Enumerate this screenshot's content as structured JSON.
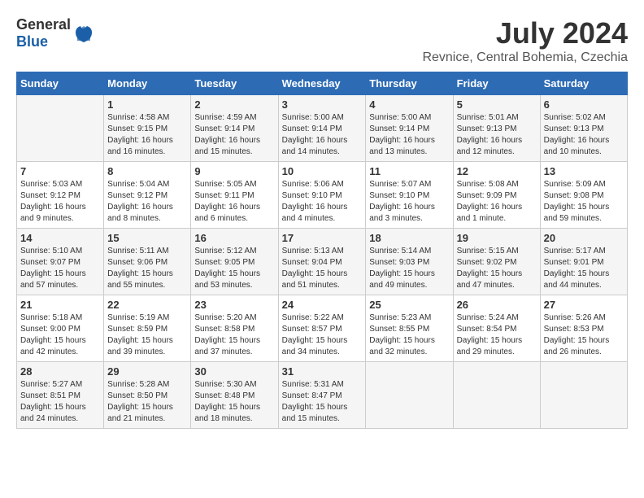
{
  "logo": {
    "general": "General",
    "blue": "Blue"
  },
  "title": {
    "month_year": "July 2024",
    "location": "Revnice, Central Bohemia, Czechia"
  },
  "headers": [
    "Sunday",
    "Monday",
    "Tuesday",
    "Wednesday",
    "Thursday",
    "Friday",
    "Saturday"
  ],
  "weeks": [
    [
      {
        "day": "",
        "sunrise": "",
        "sunset": "",
        "daylight": ""
      },
      {
        "day": "1",
        "sunrise": "Sunrise: 4:58 AM",
        "sunset": "Sunset: 9:15 PM",
        "daylight": "Daylight: 16 hours and 16 minutes."
      },
      {
        "day": "2",
        "sunrise": "Sunrise: 4:59 AM",
        "sunset": "Sunset: 9:14 PM",
        "daylight": "Daylight: 16 hours and 15 minutes."
      },
      {
        "day": "3",
        "sunrise": "Sunrise: 5:00 AM",
        "sunset": "Sunset: 9:14 PM",
        "daylight": "Daylight: 16 hours and 14 minutes."
      },
      {
        "day": "4",
        "sunrise": "Sunrise: 5:00 AM",
        "sunset": "Sunset: 9:14 PM",
        "daylight": "Daylight: 16 hours and 13 minutes."
      },
      {
        "day": "5",
        "sunrise": "Sunrise: 5:01 AM",
        "sunset": "Sunset: 9:13 PM",
        "daylight": "Daylight: 16 hours and 12 minutes."
      },
      {
        "day": "6",
        "sunrise": "Sunrise: 5:02 AM",
        "sunset": "Sunset: 9:13 PM",
        "daylight": "Daylight: 16 hours and 10 minutes."
      }
    ],
    [
      {
        "day": "7",
        "sunrise": "Sunrise: 5:03 AM",
        "sunset": "Sunset: 9:12 PM",
        "daylight": "Daylight: 16 hours and 9 minutes."
      },
      {
        "day": "8",
        "sunrise": "Sunrise: 5:04 AM",
        "sunset": "Sunset: 9:12 PM",
        "daylight": "Daylight: 16 hours and 8 minutes."
      },
      {
        "day": "9",
        "sunrise": "Sunrise: 5:05 AM",
        "sunset": "Sunset: 9:11 PM",
        "daylight": "Daylight: 16 hours and 6 minutes."
      },
      {
        "day": "10",
        "sunrise": "Sunrise: 5:06 AM",
        "sunset": "Sunset: 9:10 PM",
        "daylight": "Daylight: 16 hours and 4 minutes."
      },
      {
        "day": "11",
        "sunrise": "Sunrise: 5:07 AM",
        "sunset": "Sunset: 9:10 PM",
        "daylight": "Daylight: 16 hours and 3 minutes."
      },
      {
        "day": "12",
        "sunrise": "Sunrise: 5:08 AM",
        "sunset": "Sunset: 9:09 PM",
        "daylight": "Daylight: 16 hours and 1 minute."
      },
      {
        "day": "13",
        "sunrise": "Sunrise: 5:09 AM",
        "sunset": "Sunset: 9:08 PM",
        "daylight": "Daylight: 15 hours and 59 minutes."
      }
    ],
    [
      {
        "day": "14",
        "sunrise": "Sunrise: 5:10 AM",
        "sunset": "Sunset: 9:07 PM",
        "daylight": "Daylight: 15 hours and 57 minutes."
      },
      {
        "day": "15",
        "sunrise": "Sunrise: 5:11 AM",
        "sunset": "Sunset: 9:06 PM",
        "daylight": "Daylight: 15 hours and 55 minutes."
      },
      {
        "day": "16",
        "sunrise": "Sunrise: 5:12 AM",
        "sunset": "Sunset: 9:05 PM",
        "daylight": "Daylight: 15 hours and 53 minutes."
      },
      {
        "day": "17",
        "sunrise": "Sunrise: 5:13 AM",
        "sunset": "Sunset: 9:04 PM",
        "daylight": "Daylight: 15 hours and 51 minutes."
      },
      {
        "day": "18",
        "sunrise": "Sunrise: 5:14 AM",
        "sunset": "Sunset: 9:03 PM",
        "daylight": "Daylight: 15 hours and 49 minutes."
      },
      {
        "day": "19",
        "sunrise": "Sunrise: 5:15 AM",
        "sunset": "Sunset: 9:02 PM",
        "daylight": "Daylight: 15 hours and 47 minutes."
      },
      {
        "day": "20",
        "sunrise": "Sunrise: 5:17 AM",
        "sunset": "Sunset: 9:01 PM",
        "daylight": "Daylight: 15 hours and 44 minutes."
      }
    ],
    [
      {
        "day": "21",
        "sunrise": "Sunrise: 5:18 AM",
        "sunset": "Sunset: 9:00 PM",
        "daylight": "Daylight: 15 hours and 42 minutes."
      },
      {
        "day": "22",
        "sunrise": "Sunrise: 5:19 AM",
        "sunset": "Sunset: 8:59 PM",
        "daylight": "Daylight: 15 hours and 39 minutes."
      },
      {
        "day": "23",
        "sunrise": "Sunrise: 5:20 AM",
        "sunset": "Sunset: 8:58 PM",
        "daylight": "Daylight: 15 hours and 37 minutes."
      },
      {
        "day": "24",
        "sunrise": "Sunrise: 5:22 AM",
        "sunset": "Sunset: 8:57 PM",
        "daylight": "Daylight: 15 hours and 34 minutes."
      },
      {
        "day": "25",
        "sunrise": "Sunrise: 5:23 AM",
        "sunset": "Sunset: 8:55 PM",
        "daylight": "Daylight: 15 hours and 32 minutes."
      },
      {
        "day": "26",
        "sunrise": "Sunrise: 5:24 AM",
        "sunset": "Sunset: 8:54 PM",
        "daylight": "Daylight: 15 hours and 29 minutes."
      },
      {
        "day": "27",
        "sunrise": "Sunrise: 5:26 AM",
        "sunset": "Sunset: 8:53 PM",
        "daylight": "Daylight: 15 hours and 26 minutes."
      }
    ],
    [
      {
        "day": "28",
        "sunrise": "Sunrise: 5:27 AM",
        "sunset": "Sunset: 8:51 PM",
        "daylight": "Daylight: 15 hours and 24 minutes."
      },
      {
        "day": "29",
        "sunrise": "Sunrise: 5:28 AM",
        "sunset": "Sunset: 8:50 PM",
        "daylight": "Daylight: 15 hours and 21 minutes."
      },
      {
        "day": "30",
        "sunrise": "Sunrise: 5:30 AM",
        "sunset": "Sunset: 8:48 PM",
        "daylight": "Daylight: 15 hours and 18 minutes."
      },
      {
        "day": "31",
        "sunrise": "Sunrise: 5:31 AM",
        "sunset": "Sunset: 8:47 PM",
        "daylight": "Daylight: 15 hours and 15 minutes."
      },
      {
        "day": "",
        "sunrise": "",
        "sunset": "",
        "daylight": ""
      },
      {
        "day": "",
        "sunrise": "",
        "sunset": "",
        "daylight": ""
      },
      {
        "day": "",
        "sunrise": "",
        "sunset": "",
        "daylight": ""
      }
    ]
  ]
}
